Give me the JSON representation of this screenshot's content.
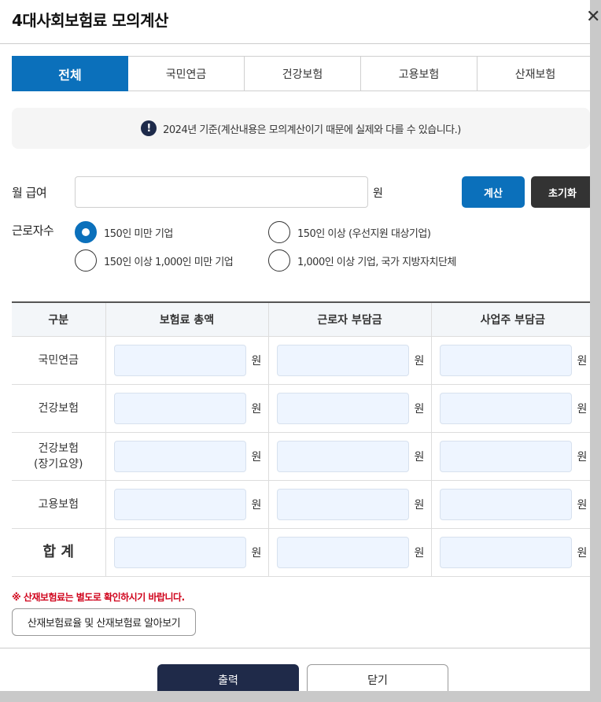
{
  "modal": {
    "title": "4대사회보험료 모의계산",
    "close_icon": "close-icon"
  },
  "tabs": [
    {
      "label": "전체",
      "active": true
    },
    {
      "label": "국민연금",
      "active": false
    },
    {
      "label": "건강보험",
      "active": false
    },
    {
      "label": "고용보험",
      "active": false
    },
    {
      "label": "산재보험",
      "active": false
    }
  ],
  "notice": {
    "icon": "exclamation-icon",
    "text": "2024년 기준(계산내용은 모의계산이기 때문에 실제와 다를 수 있습니다.)"
  },
  "form": {
    "salary_label": "월 급여",
    "salary_value": "",
    "salary_unit": "원",
    "calc_button": "계산",
    "reset_button": "초기화",
    "workers_label": "근로자수",
    "options": [
      {
        "label": "150인 미만 기업",
        "checked": true
      },
      {
        "label": "150인 이상 (우선지원 대상기업)",
        "checked": false
      },
      {
        "label": "150인 이상 1,000인 미만 기업",
        "checked": false
      },
      {
        "label": "1,000인 이상 기업, 국가 지방자치단체",
        "checked": false
      }
    ]
  },
  "table": {
    "headers": [
      "구분",
      "보험료 총액",
      "근로자 부담금",
      "사업주 부담금"
    ],
    "unit": "원",
    "rows": [
      {
        "label": "국민연금",
        "values": [
          "",
          "",
          ""
        ]
      },
      {
        "label": "건강보험",
        "values": [
          "",
          "",
          ""
        ]
      },
      {
        "label": "건강보험\n(장기요양)",
        "label_line1": "건강보험",
        "label_line2": "(장기요양)",
        "values": [
          "",
          "",
          ""
        ]
      },
      {
        "label": "고용보험",
        "values": [
          "",
          "",
          ""
        ]
      },
      {
        "label": "합 계",
        "values": [
          "",
          "",
          ""
        ]
      }
    ]
  },
  "warning": "※ 산재보험료는 별도로 확인하시기 바랍니다.",
  "info_button": "산재보험료율 및 산재보험료 알아보기",
  "footer": {
    "print_button": "출력",
    "close_button": "닫기"
  },
  "colors": {
    "accent": "#0b70bb",
    "dark_button": "#1f2a49",
    "warning": "#d0021b",
    "amount_field": "#eef5ff"
  }
}
